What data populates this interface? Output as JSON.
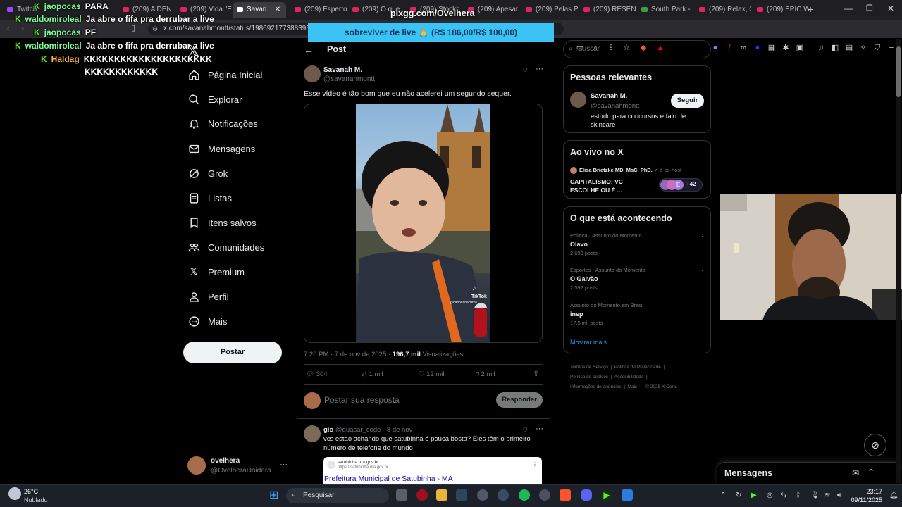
{
  "browser": {
    "tabs": [
      {
        "label": "Twitch"
      },
      {
        "label": "(209) A DEN"
      },
      {
        "label": "(209) Vida \"E"
      },
      {
        "label": "Savan"
      },
      {
        "label": "(209) Esperto"
      },
      {
        "label": "(209) O que"
      },
      {
        "label": "(209) Stockh"
      },
      {
        "label": "(209) Apesar"
      },
      {
        "label": "(209) Pelas P"
      },
      {
        "label": "(209) RESEN"
      },
      {
        "label": "South Park -"
      },
      {
        "label": "(209) Relax, C"
      },
      {
        "label": "(209) EPIC W"
      }
    ],
    "url": "x.com/savanahmontt/status/19869217738839328"
  },
  "overlay": {
    "pix_url": "pixgg.com/Ovelhera",
    "goal": "sobreviver de live 🙏 (R$ 186,00/R$ 100,00)"
  },
  "chat": [
    {
      "user": "jaopocas",
      "msg": "PARA"
    },
    {
      "user": "waldomiroleal",
      "msg": "Ja abre o fifa pra derrubar a live"
    },
    {
      "user": "jaopocas",
      "msg": "PF"
    },
    {
      "user": "waldomiroleal",
      "msg": "Ja abre o fifa pra derrubar a live"
    },
    {
      "user": "Haldag",
      "msg": "KKKKKKKKKKKKKKKKKKKKK",
      "msg2": "KKKKKKKKKKKK"
    }
  ],
  "nav": {
    "items": [
      {
        "label": "Página Inicial"
      },
      {
        "label": "Explorar"
      },
      {
        "label": "Notificações"
      },
      {
        "label": "Mensagens"
      },
      {
        "label": "Grok"
      },
      {
        "label": "Listas"
      },
      {
        "label": "Itens salvos"
      },
      {
        "label": "Comunidades"
      },
      {
        "label": "Premium"
      },
      {
        "label": "Perfil"
      },
      {
        "label": "Mais"
      }
    ],
    "post_button": "Postar",
    "account": {
      "name": "ovelhera",
      "handle": "@OvelheraDoidera"
    }
  },
  "post": {
    "header": "Post",
    "author": "Savanah M.",
    "handle": "@savanahmontt",
    "text": "Esse vídeo é tão bom que eu não acelerei um segundo sequer.",
    "video_watermark": "TikTok",
    "video_user": "@carlocanacuros",
    "time": "7:20 PM · 7 de nov de 2025 ·",
    "views": "196,7 mil",
    "views_label": "Visualizações",
    "stats": {
      "replies": "304",
      "reposts": "1 mil",
      "likes": "12 mil",
      "bookmarks": "2 mil"
    },
    "reply_placeholder": "Postar sua resposta",
    "reply_button": "Responder"
  },
  "reply": {
    "author": "gio",
    "handle": "@quasar_code",
    "date": "· 8 de nov",
    "text": "vcs estao achando que satubinha é pouca bosta? Eles têm o primeiro número de telefone do mundo",
    "link_domain": "satubinha.ma.gov.br",
    "link_url": "https://satubinha.ma.gov.br",
    "link_title": "Prefeitura Municipal de Satubinha - MA"
  },
  "sidebar": {
    "search_placeholder": "Buscar",
    "relevant": {
      "title": "Pessoas relevantes",
      "name": "Savanah M.",
      "handle": "@savanahmontt",
      "bio": "estudo para concursos e falo de skincare",
      "follow": "Seguir"
    },
    "live": {
      "title": "Ao vivo no X",
      "host": "Elisa Brietzke MD, MsC, PhD.",
      "host_suffix": "é co-host",
      "topic": "CAPITALISMO: VC ESCOLHE OU É ...",
      "count": "+42"
    },
    "trends": {
      "title": "O que está acontecendo",
      "items": [
        {
          "context": "Política · Assunto do Momento",
          "name": "Olavo",
          "posts": "2.693 posts"
        },
        {
          "context": "Esportes · Assunto do Momento",
          "name": "O Galvão",
          "posts": "2.592 posts"
        },
        {
          "context": "Assunto do Momento em Brasil",
          "name": "inep",
          "posts": "17,5 mil posts"
        }
      ],
      "more": "Mostrar mais"
    },
    "footer": {
      "l1": "Termos de Serviço",
      "l2": "Política de Privacidade",
      "l3": "Política de cookies",
      "l4": "Acessibilidade",
      "l5": "Informações de anúncios",
      "l6": "Mais ···",
      "l7": "© 2025 X Corp."
    },
    "messages_drawer": "Mensagens"
  },
  "taskbar": {
    "weather_temp": "26°C",
    "weather_desc": "Nublado",
    "search": "Pesquisar",
    "time": "23:17",
    "date": "09/11/2025"
  },
  "colors": {
    "accent": "#1d9bf0",
    "kick_green": "#53fc18",
    "goal_bg": "#3cc3f5"
  }
}
